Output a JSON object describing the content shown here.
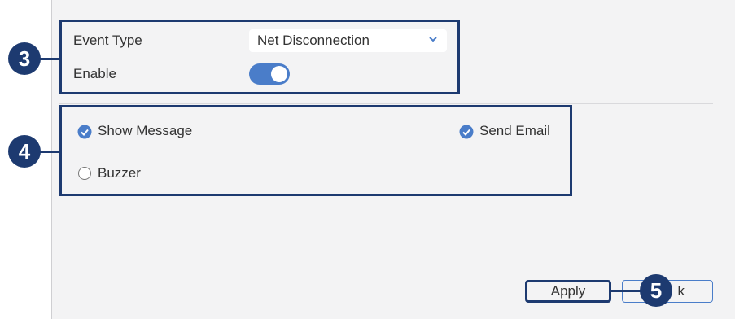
{
  "event_type": {
    "label": "Event Type",
    "value": "Net Disconnection"
  },
  "enable": {
    "label": "Enable",
    "on": true
  },
  "actions": {
    "show_message": {
      "label": "Show Message",
      "checked": true
    },
    "send_email": {
      "label": "Send Email",
      "checked": true
    },
    "buzzer": {
      "label": "Buzzer",
      "checked": false
    }
  },
  "buttons": {
    "apply": "Apply",
    "back": "Back",
    "back_visible": "k"
  },
  "callouts": {
    "a": "3",
    "b": "4",
    "c": "5"
  },
  "colors": {
    "accent": "#4a7dc9",
    "callout": "#1d3a70",
    "panel": "#f3f3f4"
  }
}
